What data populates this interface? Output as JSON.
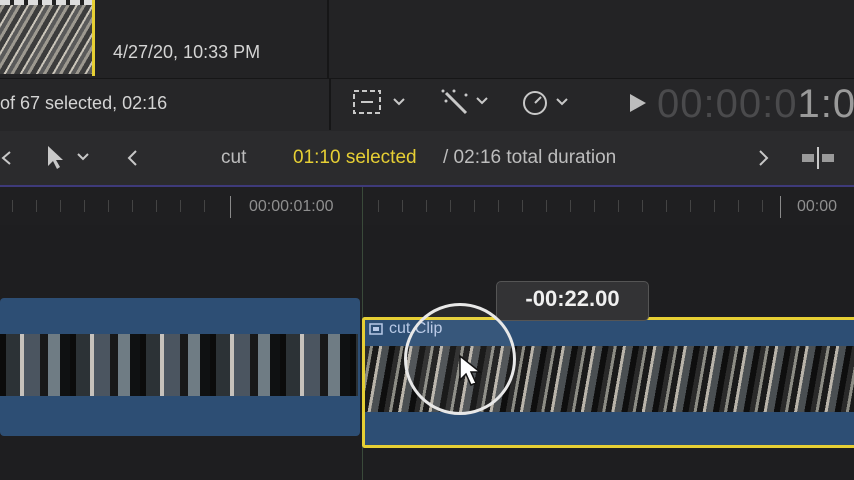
{
  "browser": {
    "clip_date": "4/27/20, 10:33 PM",
    "selection_count": "of 67 selected, 02:16"
  },
  "toolbar": {
    "transform_icon": "transform-crop-icon",
    "enhance_icon": "magic-wand-icon",
    "retime_icon": "speedometer-icon",
    "play_icon": "play-icon",
    "timecode_dim": "00:00:0",
    "timecode_bright": "1:0"
  },
  "timeline_header": {
    "project_name": "cut",
    "selected_duration": "01:10 selected",
    "total_duration": "/ 02:16 total duration"
  },
  "ruler": {
    "label_1": "00:00:01:00",
    "label_2": "00:00"
  },
  "clip": {
    "name": "cut Clip",
    "drag_offset": "-00:22.00"
  },
  "colors": {
    "selection_yellow": "#e6cf34",
    "clip_blue": "#2d4e74",
    "background": "#1f1f21"
  }
}
